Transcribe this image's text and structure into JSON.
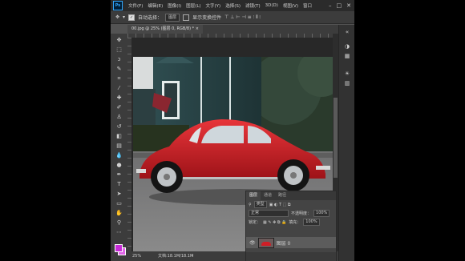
{
  "menubar": {
    "logo": "Ps",
    "items": [
      "文件(F)",
      "编辑(E)",
      "图像(I)",
      "图层(L)",
      "文字(Y)",
      "选择(S)",
      "滤镜(T)",
      "3D(D)",
      "视图(V)",
      "窗口"
    ],
    "window_controls": [
      "–",
      "□",
      "✕"
    ]
  },
  "options": {
    "auto_select_label": "自动选择：",
    "auto_select_value": "图层",
    "show_transform_label": "显示变换控件"
  },
  "document": {
    "tab_title": "00.jpg @ 25% (图层 0, RGB/8) *",
    "tab_close": "×"
  },
  "status": {
    "zoom": "25%",
    "doc_info": "文档:18.1M/18.1M"
  },
  "layers_panel": {
    "tabs": [
      "图层",
      "通道",
      "路径"
    ],
    "filter_label": "类型",
    "blend_mode": "正常",
    "opacity_label": "不透明度：",
    "opacity_value": "100%",
    "lock_label": "锁定：",
    "fill_label": "填充：",
    "fill_value": "100%",
    "layer_name": "图层 0"
  },
  "colors": {
    "foreground": "#c62ad6",
    "background": "#e064e8",
    "car": "#cf1e26"
  }
}
